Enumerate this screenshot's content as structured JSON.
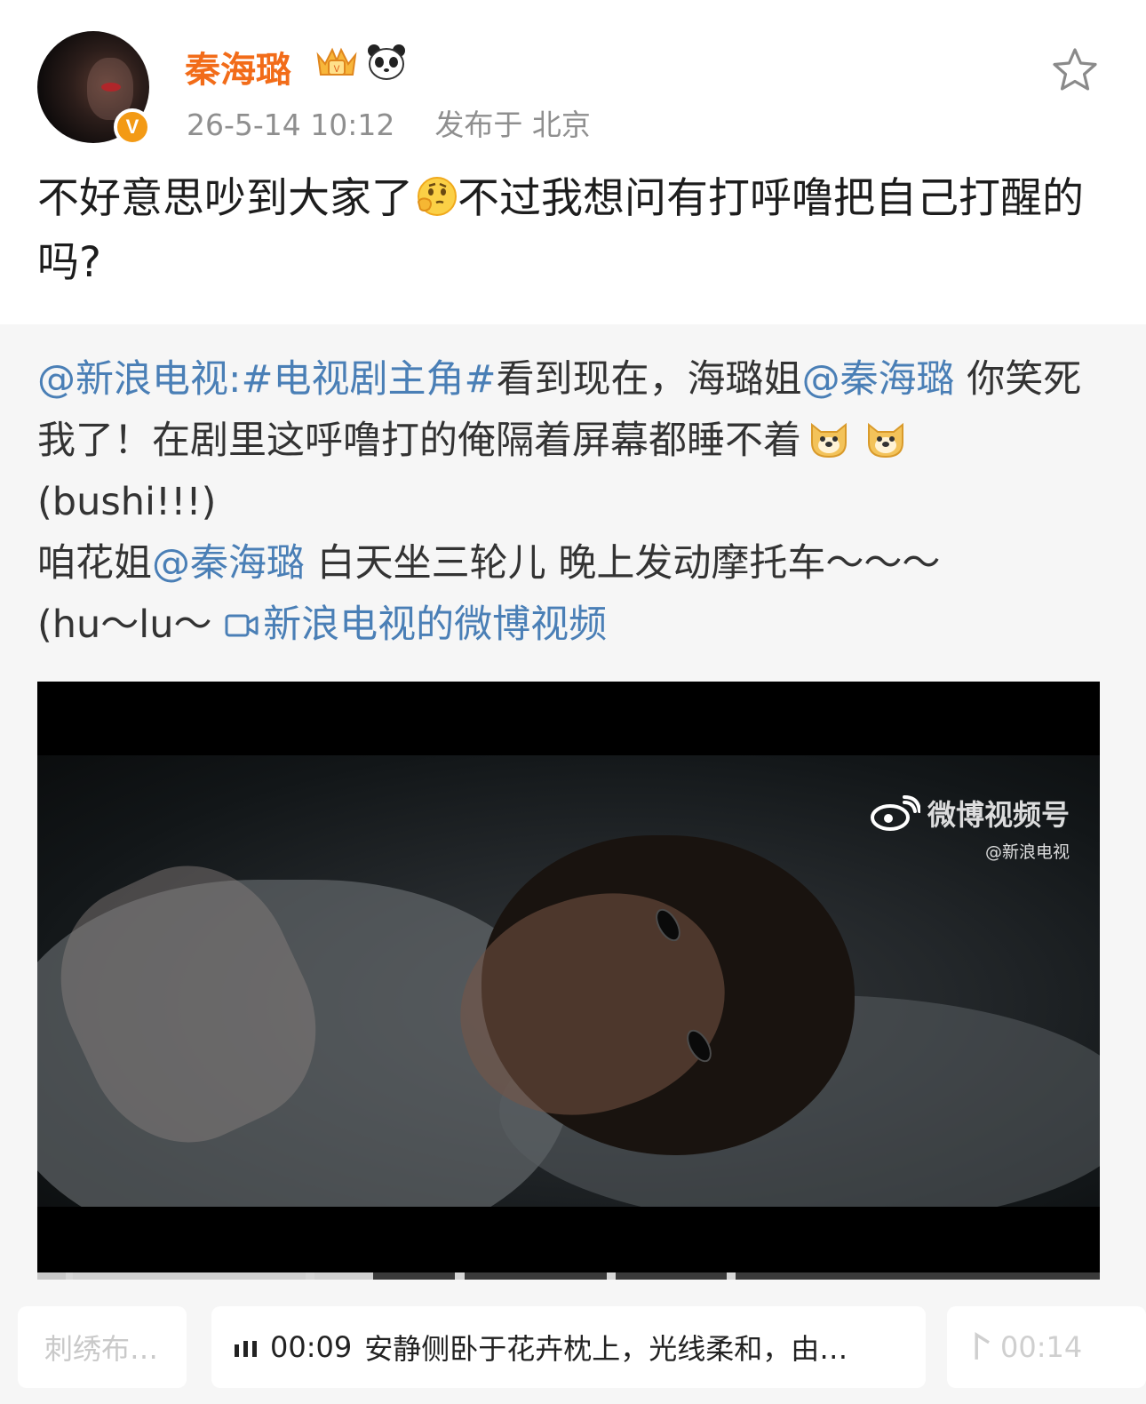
{
  "post": {
    "username": "秦海璐",
    "date": "26-5-14 10:12",
    "location": "发布于 北京",
    "verified_badge": "V",
    "text_part1": "不好意思吵到大家了",
    "text_part2": "不过我想问有打呼噜把自己打醒的吗?",
    "accent_color": "#f26c19",
    "icons": [
      "crown-icon",
      "panda-icon",
      "star-icon",
      "thinking-emoji"
    ]
  },
  "repost": {
    "mention_source": "@新浪电视",
    "colon": ":",
    "hashtag": "#电视剧主角#",
    "text_a": "看到现在，海璐姐",
    "mention_1": "@秦海璐",
    "text_b": " 你笑死我了！在剧里这呼噜打的俺隔着屏幕都睡不着",
    "text_c": "(bushi!!!)",
    "text_d": "咱花姐",
    "mention_2": "@秦海璐",
    "text_e": " 白天坐三轮儿 晚上发动摩托车～～～",
    "text_f": "(hu～lu～ ",
    "video_link": "新浪电视的微博视频",
    "link_color": "#4a7fb6"
  },
  "video": {
    "watermark_title": "微博视频号",
    "watermark_sub": "@新浪电视"
  },
  "subtitles": {
    "prev": "刺绣布…",
    "current_time": "00:09",
    "current_text": "安静侧卧于花卉枕上，光线柔和，由…",
    "next": "00:14"
  }
}
